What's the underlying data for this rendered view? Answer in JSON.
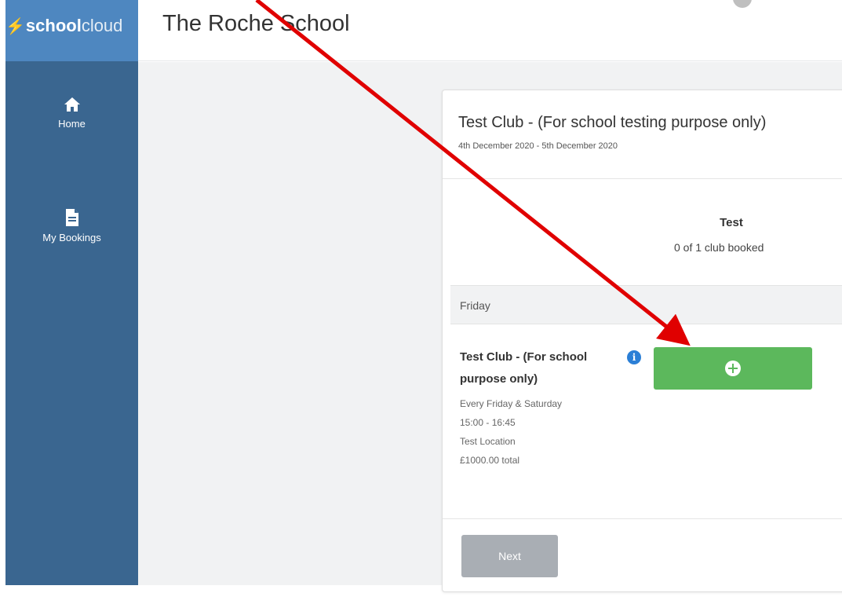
{
  "brand": {
    "logo_bold": "school",
    "logo_light": "cloud"
  },
  "header": {
    "school_name": "The Roche School"
  },
  "sidebar": {
    "items": [
      {
        "label": "Home",
        "icon": "home-icon"
      },
      {
        "label": "My Bookings",
        "icon": "document-icon"
      }
    ]
  },
  "card": {
    "title": "Test Club - (For school testing purpose only)",
    "dates": "4th December 2020 - 5th December 2020",
    "club_name": "Test",
    "club_count": "0 of 1 club booked",
    "day": "Friday",
    "activity": {
      "name": "Test Club - (For school purpose only)",
      "schedule": "Every Friday & Saturday",
      "time": "15:00 - 16:45",
      "location": "Test Location",
      "price": "£1000.00 total",
      "info_icon": "info-icon",
      "add_icon": "plus-circle-icon"
    },
    "next_label": "Next"
  },
  "colors": {
    "sidebar": "#3a6690",
    "logo_bar": "#4e87c0",
    "add_button": "#5cb85c",
    "next_button": "#a9aeb4",
    "annotation_arrow": "#e00000"
  }
}
